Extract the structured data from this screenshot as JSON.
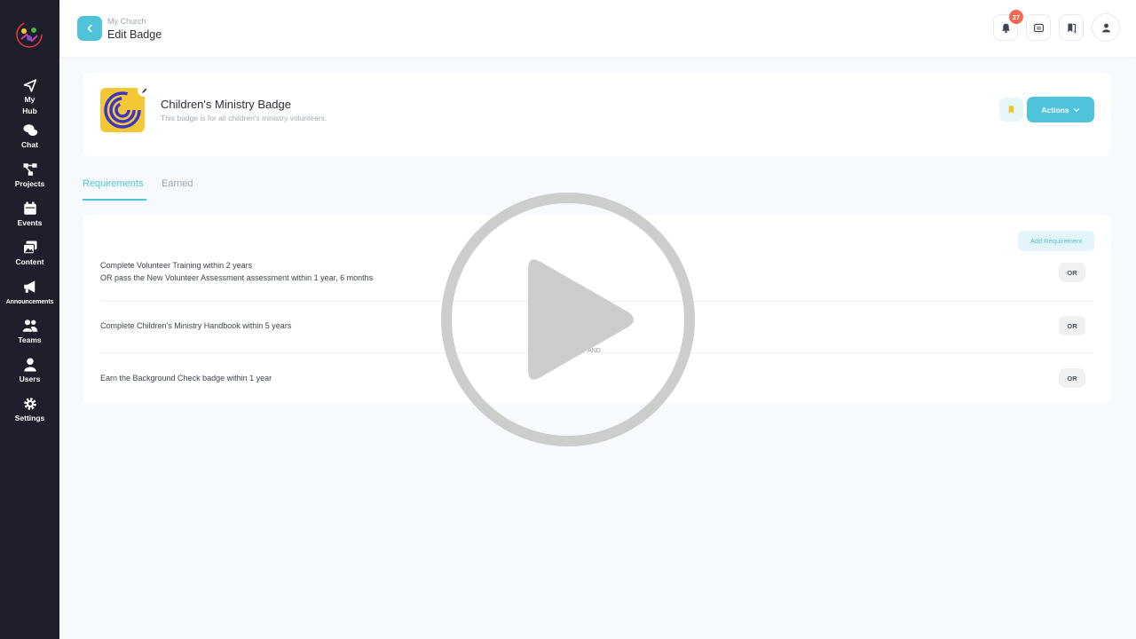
{
  "sidebar": {
    "items": [
      {
        "label": "My\nHub",
        "icon": "paper-plane-icon"
      },
      {
        "label": "Chat",
        "icon": "chat-bubbles-icon"
      },
      {
        "label": "Projects",
        "icon": "projects-icon"
      },
      {
        "label": "Events",
        "icon": "calendar-icon"
      },
      {
        "label": "Content",
        "icon": "images-icon"
      },
      {
        "label": "Announcements",
        "icon": "megaphone-icon"
      },
      {
        "label": "Teams",
        "icon": "team-icon"
      },
      {
        "label": "Users",
        "icon": "user-icon"
      },
      {
        "label": "Settings",
        "icon": "gear-icon"
      }
    ]
  },
  "header": {
    "breadcrumb": "My Church",
    "title": "Edit Badge",
    "notification_count": "27"
  },
  "badge": {
    "name": "Children's Ministry Badge",
    "description": "This badge is for all children's ministry volunteers.",
    "actions_label": "Actions"
  },
  "tabs": [
    {
      "label": "Requirements",
      "active": true
    },
    {
      "label": "Earned",
      "active": false
    }
  ],
  "requirements": {
    "add_label": "Add Requirement",
    "items": [
      {
        "lines": [
          "Complete Volunteer Training within 2 years",
          "OR pass the New Volunteer Assessment assessment within 1 year, 6 months"
        ],
        "button": "OR"
      },
      {
        "lines": [
          "Complete Children's Ministry Handbook within 5 years"
        ],
        "button": "OR"
      },
      {
        "lines": [
          "Earn the Background Check badge within 1 year"
        ],
        "button": "OR"
      }
    ],
    "connector": "AND"
  },
  "colors": {
    "accent": "#4fc3d9",
    "sidebar_bg": "#1e1f2b",
    "notification": "#f26a4f",
    "badge_bg": "#f4c736"
  }
}
